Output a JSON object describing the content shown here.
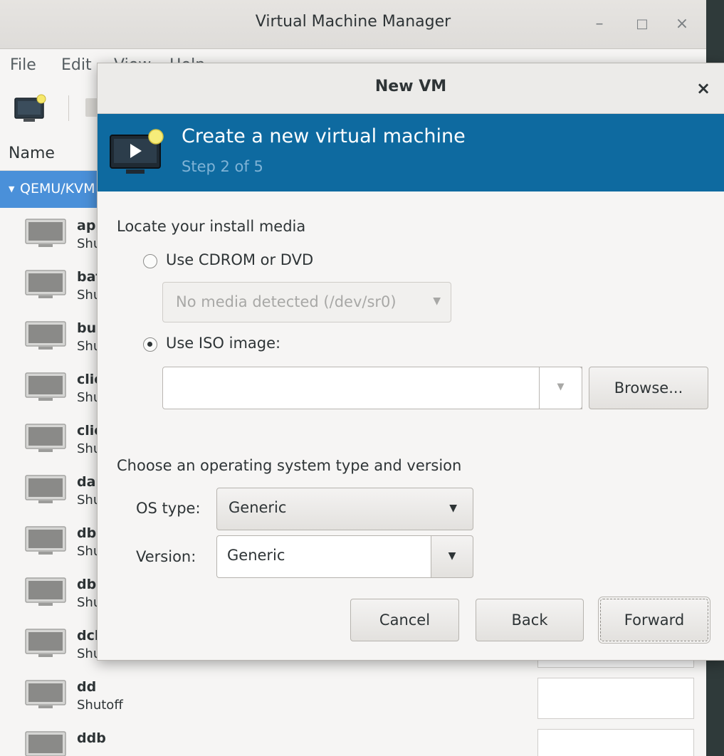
{
  "main_window": {
    "title": "Virtual Machine Manager",
    "controls": {
      "minimize": "–",
      "maximize": "□",
      "close": "×"
    },
    "menu": [
      "File",
      "Edit",
      "View",
      "Help"
    ],
    "list": {
      "column_name": "Name",
      "group": "QEMU/KVM",
      "vms": [
        {
          "name": "app",
          "status": "Shutoff"
        },
        {
          "name": "bat",
          "status": "Shutoff"
        },
        {
          "name": "bui",
          "status": "Shutoff"
        },
        {
          "name": "clie",
          "status": "Shutoff"
        },
        {
          "name": "clie",
          "status": "Shutoff"
        },
        {
          "name": "dap",
          "status": "Shutoff"
        },
        {
          "name": "db",
          "status": "Shutoff"
        },
        {
          "name": "dba",
          "status": "Shutoff"
        },
        {
          "name": "dcl",
          "status": "Shutoff"
        },
        {
          "name": "dd",
          "status": "Shutoff"
        },
        {
          "name": "ddb",
          "status": ""
        }
      ]
    }
  },
  "dialog": {
    "title": "New VM",
    "close": "×",
    "banner": {
      "heading": "Create a new virtual machine",
      "step": "Step 2 of 5"
    },
    "install_media": {
      "label": "Locate your install media",
      "cdrom_option": "Use CDROM or DVD",
      "cdrom_value": "No media detected (/dev/sr0)",
      "iso_option": "Use ISO image:",
      "iso_value": "",
      "browse_label": "Browse..."
    },
    "os": {
      "label": "Choose an operating system type and version",
      "type_label": "OS type:",
      "type_value": "Generic",
      "version_label": "Version:",
      "version_value": "Generic"
    },
    "buttons": {
      "cancel": "Cancel",
      "back": "Back",
      "forward": "Forward"
    }
  }
}
